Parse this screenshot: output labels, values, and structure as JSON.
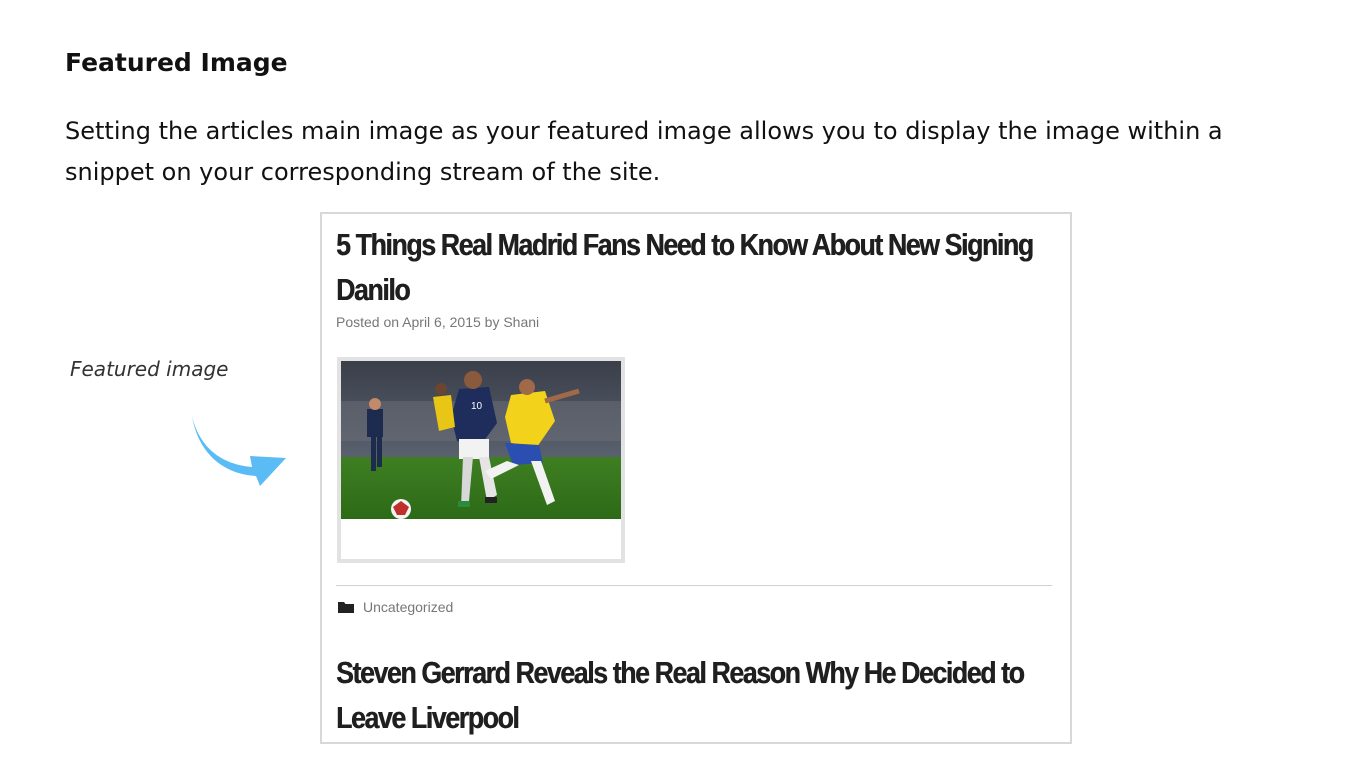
{
  "section": {
    "heading": "Featured Image",
    "intro": "Setting the articles main image as your featured image allows you to display the image within a snippet on your corresponding stream of the site."
  },
  "callout": {
    "label": "Featured image",
    "arrow_icon": "curved-arrow-icon",
    "arrow_color": "#5bbcf5"
  },
  "snippet": {
    "posts": [
      {
        "title": "5 Things Real Madrid Fans Need to Know About New Signing Danilo",
        "meta": "Posted on April 6, 2015 by Shani",
        "category": "Uncategorized",
        "category_icon": "folder-icon"
      },
      {
        "title": "Steven Gerrard Reveals the Real Reason Why He Decided to Leave Liverpool"
      }
    ]
  }
}
